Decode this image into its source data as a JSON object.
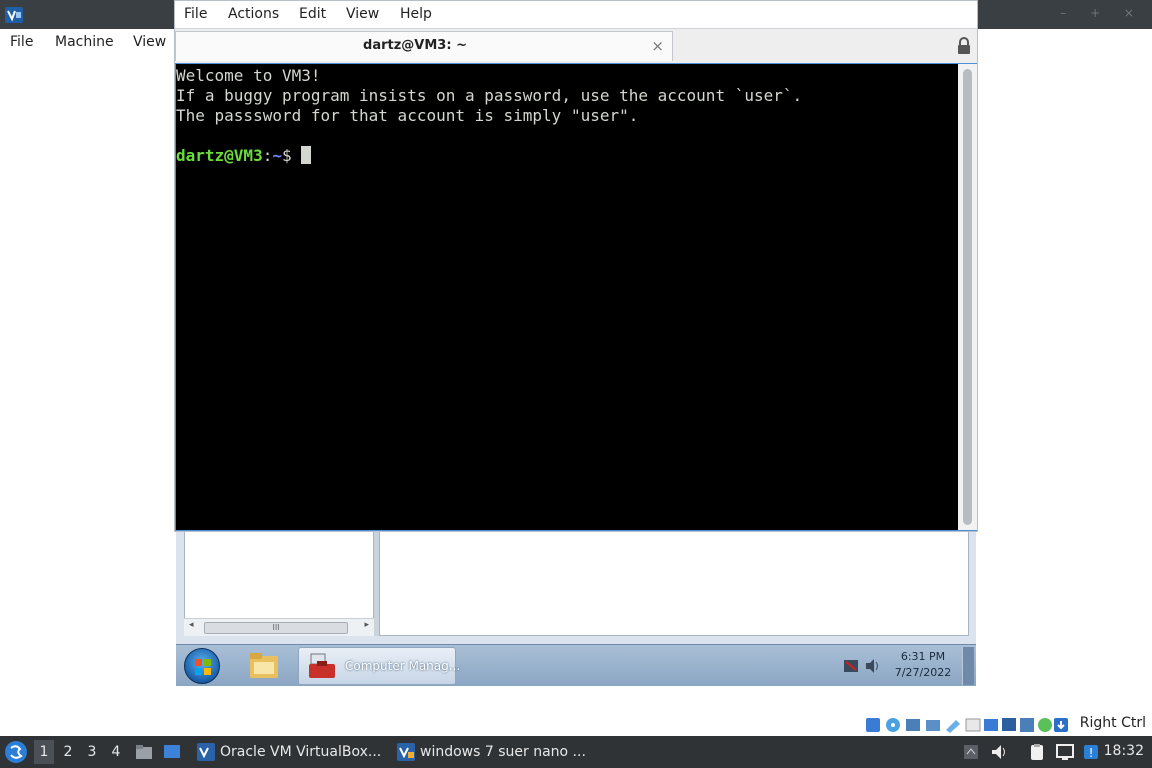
{
  "host_window": {
    "menu": [
      "File",
      "Machine",
      "View"
    ]
  },
  "terminal": {
    "menu": [
      "File",
      "Actions",
      "Edit",
      "View",
      "Help"
    ],
    "tab_title": "dartz@VM3: ~",
    "lines": [
      "Welcome to VM3!",
      "If a buggy program insists on a password, use the account `user`.",
      "The passsword for that account is simply \"user\"."
    ],
    "prompt_user": "dartz@VM3",
    "prompt_sep": ":",
    "prompt_path": "~",
    "prompt_symbol": "$ "
  },
  "guest": {
    "task_label": "Computer Manag...",
    "clock_time": "6:31 PM",
    "clock_date": "7/27/2022",
    "scroll_thumb": "III"
  },
  "vbox_status": {
    "host_key": "Right Ctrl"
  },
  "panel": {
    "workspaces": [
      "1",
      "2",
      "3",
      "4"
    ],
    "tasks": [
      "Oracle VM VirtualBox...",
      "windows 7 suer nano ..."
    ],
    "clock": "18:32"
  },
  "colors": {
    "terminal_bg": "#000000",
    "prompt_user": "#6bdc3c",
    "prompt_path": "#6f86ff",
    "panel_bg": "#2f3336",
    "win7_taskbar": "#a9bfd6"
  }
}
